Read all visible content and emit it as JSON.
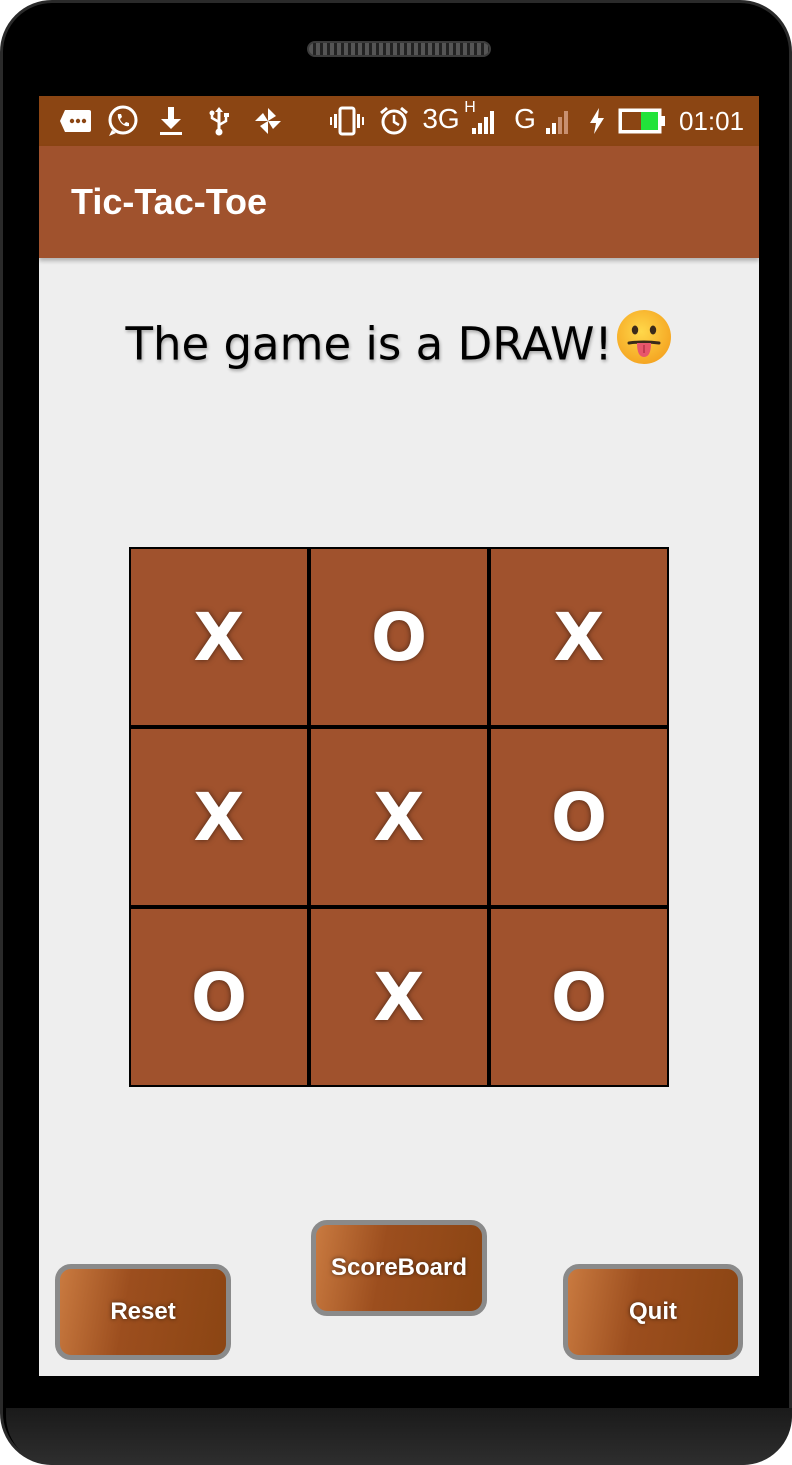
{
  "status_bar": {
    "icons": [
      "message-icon",
      "whatsapp-icon",
      "download-icon",
      "usb-icon",
      "pinwheel-icon",
      "vibrate-icon",
      "alarm-icon",
      "signal-icon",
      "signal-icon",
      "charging-icon",
      "battery-icon"
    ],
    "network_1": "3G",
    "network_1_sup": "H",
    "network_2": "G",
    "time": "01:01"
  },
  "app_bar": {
    "title": "Tic-Tac-Toe"
  },
  "game": {
    "status_message": "The game is a DRAW!",
    "emoji_icon": "face-with-tongue-icon",
    "board": [
      [
        "X",
        "O",
        "X"
      ],
      [
        "X",
        "X",
        "O"
      ],
      [
        "O",
        "X",
        "O"
      ]
    ]
  },
  "buttons": {
    "reset_label": "Reset",
    "scoreboard_label": "ScoreBoard",
    "quit_label": "Quit"
  },
  "colors": {
    "status_bar": "#8b4513",
    "app_bar": "#a0522d",
    "cell": "#a0522d",
    "background": "#eeeeee"
  }
}
